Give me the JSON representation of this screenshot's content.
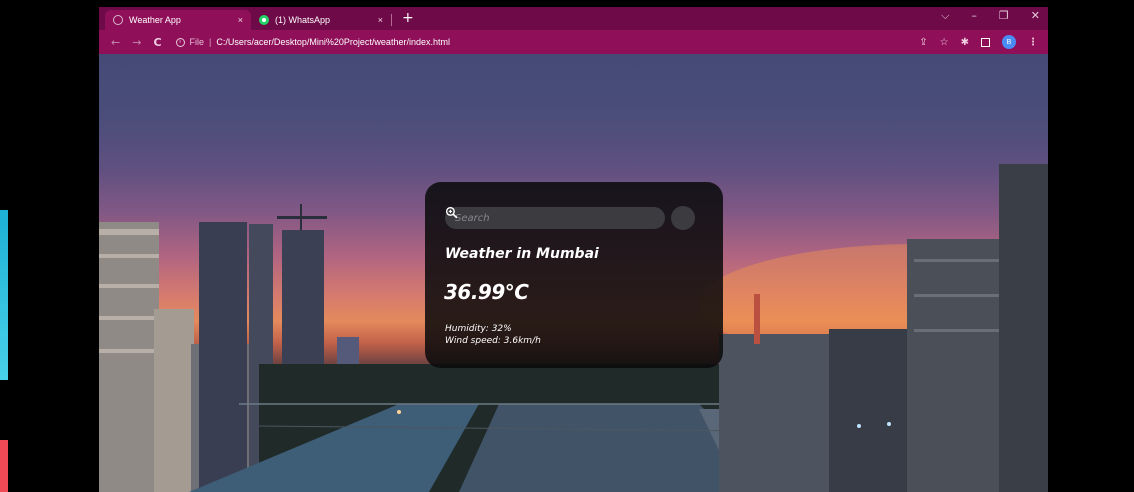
{
  "browser": {
    "tabs": [
      {
        "title": "Weather App",
        "close": "×"
      },
      {
        "title": "(1) WhatsApp",
        "close": "×"
      }
    ],
    "new_tab": "+",
    "window_controls": {
      "chevron": "⌵",
      "minimize": "–",
      "restore": "❐",
      "close": "✕"
    },
    "toolbar": {
      "back": "←",
      "forward": "→",
      "reload": "C",
      "scheme": "File",
      "url": "C:/Users/acer/Desktop/Mini%20Project/weather/index.html",
      "share": "⇪",
      "bookmark": "☆",
      "extensions": "✱",
      "profile": "B",
      "menu": "⋮"
    }
  },
  "weather": {
    "search": {
      "placeholder": "Search",
      "value": ""
    },
    "city": "Weather in Mumbai",
    "temperature": "36.99°C",
    "humidity": "Humidity: 32%",
    "wind": "Wind speed: 3.6km/h"
  },
  "colors": {
    "tabstrip": "#6e0a47",
    "toolbar": "#8f1059",
    "card": "#0a0a0c",
    "input": "#3b3b40"
  },
  "icons": {
    "search_button": "magnifier-plus-icon",
    "site_info": "info-icon",
    "tab_favicon": "globe-icon",
    "whatsapp_favicon": "whatsapp-icon"
  }
}
